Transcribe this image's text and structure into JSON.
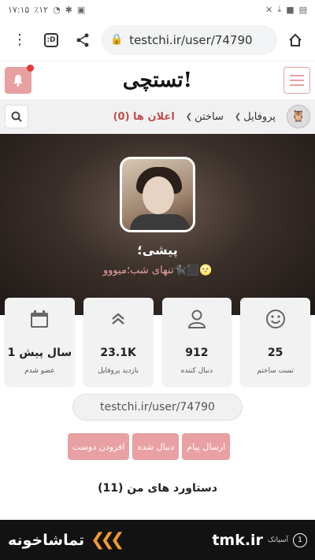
{
  "statusbar": {
    "time": "۱۷:۱۵",
    "battery": "٪۱۲"
  },
  "browser": {
    "url": "testchi.ir/user/74790",
    "tab_icon": ":D"
  },
  "site": {
    "logo": "تستچی!"
  },
  "nav": {
    "profile": "پروفایل",
    "build": "ساختن",
    "notifications": "اعلان ها (0)"
  },
  "profile": {
    "name": "پیشی؛",
    "bio": "تنهای شب؛میووو🐈‍⬛⬛🌝"
  },
  "stats": [
    {
      "icon": "calendar-icon",
      "value": "1 سال پیش",
      "label": "عضو شدم"
    },
    {
      "icon": "chevrons-up-icon",
      "value": "23.1K",
      "label": "بازدید پروفایل"
    },
    {
      "icon": "user-icon",
      "value": "912",
      "label": "دنبال کننده"
    },
    {
      "icon": "smile-icon",
      "value": "25",
      "label": "تست ساختم"
    }
  ],
  "profile_url": "testchi.ir/user/74790",
  "actions": {
    "add_friend": "افزودن دوست",
    "followed": "دنبال شده",
    "send_message": "ارسال پیام"
  },
  "achievements": "دستاورد های من (11)",
  "ad": {
    "brand_left": "تماشاخونه",
    "brand_right": "tmk.ir",
    "small_text": "آسیاتک",
    "badge": "1"
  },
  "colors": {
    "accent": "#e8a0a3",
    "notification": "#c0504d"
  }
}
